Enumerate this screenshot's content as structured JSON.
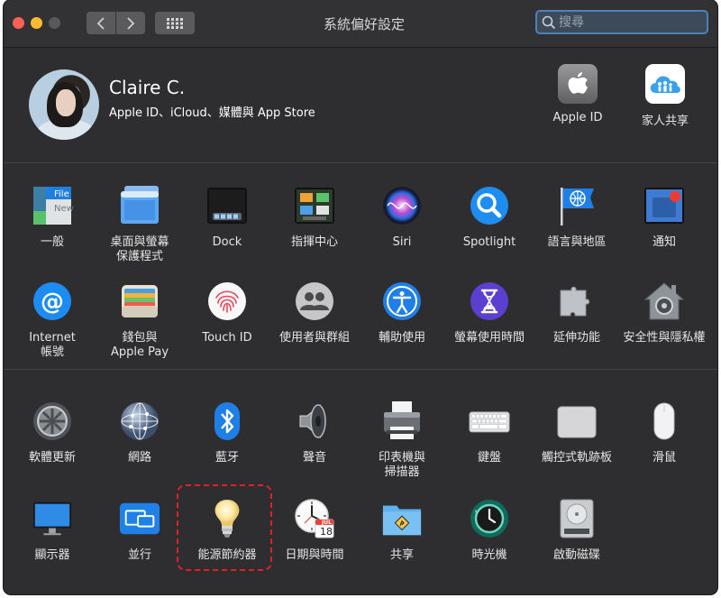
{
  "window": {
    "title": "系統偏好設定"
  },
  "search": {
    "placeholder": "搜尋"
  },
  "account": {
    "name": "Claire C.",
    "subtitle": "Apple ID、iCloud、媒體與 App Store",
    "apple_id_label": "Apple ID",
    "family_label": "家人共享"
  },
  "prefs_row1": [
    "一般",
    "桌面與螢幕\n保護程式",
    "Dock",
    "指揮中心",
    "Siri",
    "Spotlight",
    "語言與地區",
    "通知"
  ],
  "prefs_row2": [
    "Internet\n帳號",
    "錢包與\nApple Pay",
    "Touch ID",
    "使用者與群組",
    "輔助使用",
    "螢幕使用時間",
    "延伸功能",
    "安全性與隱私權"
  ],
  "prefs_row3": [
    "軟體更新",
    "網路",
    "藍牙",
    "聲音",
    "印表機與\n掃描器",
    "鍵盤",
    "觸控式軌跡板",
    "滑鼠"
  ],
  "prefs_row4": [
    "顯示器",
    "並行",
    "能源節約器",
    "日期與時間",
    "共享",
    "時光機",
    "啟動磁碟"
  ],
  "icons": {
    "general_file_text": "File",
    "general_new_text": "New",
    "calendar_month": "JUL",
    "calendar_day": "18"
  },
  "colors": {
    "highlight": "#e0202a",
    "search_border": "#4d82b8"
  }
}
